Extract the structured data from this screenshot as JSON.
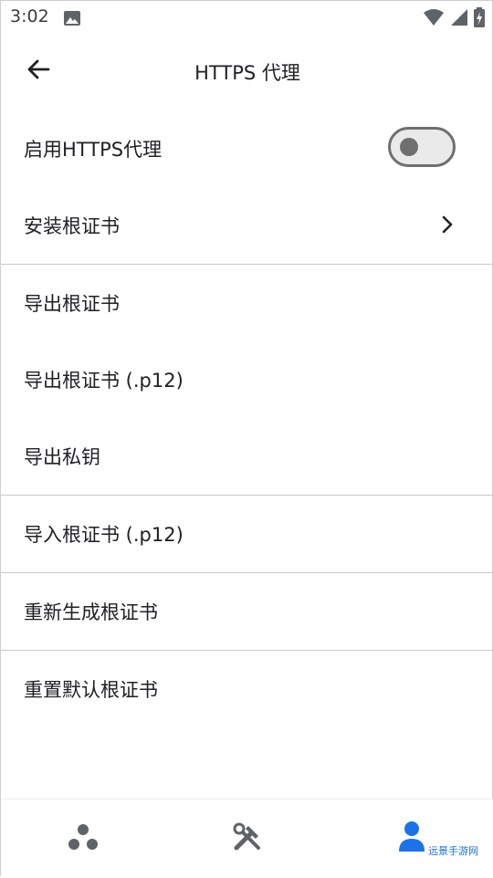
{
  "status_bar": {
    "time": "3:02",
    "icons": [
      "gallery-icon",
      "wifi-icon",
      "signal-icon",
      "battery-charging-icon"
    ]
  },
  "app_bar": {
    "title": "HTTPS 代理",
    "back_icon": "arrow-left-icon"
  },
  "settings": {
    "enable_https_proxy": {
      "label": "启用HTTPS代理",
      "enabled": false
    },
    "install_root_cert": {
      "label": "安装根证书",
      "icon": "chevron-right-icon"
    },
    "export_root_cert": "导出根证书",
    "export_root_cert_p12": "导出根证书 (.p12)",
    "export_private_key": "导出私钥",
    "import_root_cert_p12": "导入根证书 (.p12)",
    "regenerate_root_cert": "重新生成根证书",
    "reset_default_root_cert": "重置默认根证书"
  },
  "bottom_nav": {
    "items": [
      {
        "icon": "nodes-icon",
        "active": false
      },
      {
        "icon": "tools-icon",
        "active": false
      },
      {
        "icon": "person-icon",
        "active": true
      }
    ]
  },
  "watermark": "远景手游网",
  "colors": {
    "accent": "#1a73e8",
    "text": "#202124",
    "divider": "#c9c9c9",
    "toggle": "#6f6f6f"
  }
}
